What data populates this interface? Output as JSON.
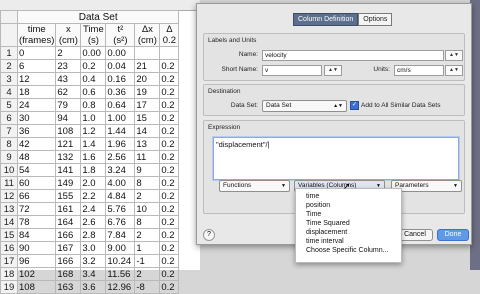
{
  "sheet": {
    "title": "Data Set",
    "headers": [
      {
        "name": "time",
        "unit": "(frames)"
      },
      {
        "name": "x",
        "unit": "(cm)"
      },
      {
        "name": "Time",
        "unit": "(s)"
      },
      {
        "name": "t²",
        "unit": "(s²)"
      },
      {
        "name": "Δx",
        "unit": "(cm)"
      },
      {
        "name": "Δ",
        "unit": "0.2"
      }
    ],
    "rows": [
      [
        "1",
        "0",
        "2",
        "0.00",
        "0.00",
        "",
        ""
      ],
      [
        "2",
        "6",
        "23",
        "0.2",
        "0.04",
        "21",
        "0.2"
      ],
      [
        "3",
        "12",
        "43",
        "0.4",
        "0.16",
        "20",
        "0.2"
      ],
      [
        "4",
        "18",
        "62",
        "0.6",
        "0.36",
        "19",
        "0.2"
      ],
      [
        "5",
        "24",
        "79",
        "0.8",
        "0.64",
        "17",
        "0.2"
      ],
      [
        "6",
        "30",
        "94",
        "1.0",
        "1.00",
        "15",
        "0.2"
      ],
      [
        "7",
        "36",
        "108",
        "1.2",
        "1.44",
        "14",
        "0.2"
      ],
      [
        "8",
        "42",
        "121",
        "1.4",
        "1.96",
        "13",
        "0.2"
      ],
      [
        "9",
        "48",
        "132",
        "1.6",
        "2.56",
        "11",
        "0.2"
      ],
      [
        "10",
        "54",
        "141",
        "1.8",
        "3.24",
        "9",
        "0.2"
      ],
      [
        "11",
        "60",
        "149",
        "2.0",
        "4.00",
        "8",
        "0.2"
      ],
      [
        "12",
        "66",
        "155",
        "2.2",
        "4.84",
        "2",
        "0.2"
      ],
      [
        "13",
        "72",
        "161",
        "2.4",
        "5.76",
        "10",
        "0.2"
      ],
      [
        "14",
        "78",
        "164",
        "2.6",
        "6.76",
        "8",
        "0.2"
      ],
      [
        "15",
        "84",
        "166",
        "2.8",
        "7.84",
        "2",
        "0.2"
      ],
      [
        "16",
        "90",
        "167",
        "3.0",
        "9.00",
        "1",
        "0.2"
      ],
      [
        "17",
        "96",
        "166",
        "3.2",
        "10.24",
        "-1",
        "0.2"
      ],
      [
        "18",
        "102",
        "168",
        "3.4",
        "11.56",
        "2",
        "0.2"
      ],
      [
        "19",
        "108",
        "163",
        "3.6",
        "12.96",
        "-8",
        "0.2"
      ]
    ]
  },
  "dialog": {
    "tabs": [
      "Column Definition",
      "Options"
    ],
    "labels_units": {
      "group_label": "Labels and Units",
      "name_label": "Name:",
      "name_value": "velocity",
      "short_label": "Short Name:",
      "short_value": "v",
      "units_label": "Units:",
      "units_value": "cm/s",
      "spin": "▲▼"
    },
    "destination": {
      "group_label": "Destination",
      "dataset_label": "Data Set:",
      "dataset_value": "Data Set",
      "add_all_label": "Add to All Similar Data Sets",
      "checked": true
    },
    "expression": {
      "group_label": "Expression",
      "value": "\"displacement\"/"
    },
    "functions_label": "Functions",
    "variables_label": "Variables (Columns)",
    "parameters_label": "Parameters",
    "menu_items": [
      "time",
      "position",
      "Time",
      "Time Squared",
      "displacement",
      "time interval",
      "Choose Specific Column..."
    ],
    "cancel_label": "Cancel",
    "done_label": "Done",
    "help_label": "?"
  },
  "colors": {
    "accent": "#5f9ae6",
    "tab_active": "#5c6f8d"
  }
}
